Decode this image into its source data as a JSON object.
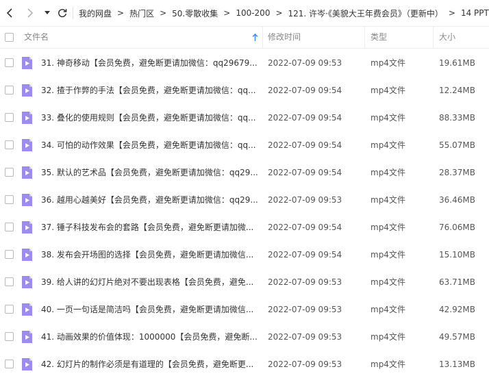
{
  "breadcrumbs": [
    "我的网盘",
    "热门区",
    "50.零散收集",
    "100-200",
    "121. 许岑·《美貌大王年费会员》（更新中）",
    "14 PPT"
  ],
  "columns": {
    "name": "文件名",
    "modified": "修改时间",
    "type": "类型",
    "size": "大小"
  },
  "colors": {
    "accent": "#3b8cff",
    "file_icon": "#9b8bee",
    "file_icon_fold": "#c9c0f7"
  },
  "files": [
    {
      "name": "31. 神奇移动【会员免费，避免断更请加微信：qq29679...",
      "modified": "2022-07-09 09:53",
      "type": "mp4文件",
      "size": "19.61MB"
    },
    {
      "name": "32. 揸于作弊的手法【会员免费，避免断更请加微信：qq...",
      "modified": "2022-07-09 09:54",
      "type": "mp4文件",
      "size": "12.24MB"
    },
    {
      "name": "33. 叠化的使用规则【会员免费，避免断更请加微信：qq...",
      "modified": "2022-07-09 09:54",
      "type": "mp4文件",
      "size": "88.33MB"
    },
    {
      "name": "34. 可怕的动作效果【会员免费，避免断更请加微信：qq...",
      "modified": "2022-07-09 09:54",
      "type": "mp4文件",
      "size": "55.07MB"
    },
    {
      "name": "35. 默认的艺术品【会员免费，避免断更请加微信：qq29...",
      "modified": "2022-07-09 09:54",
      "type": "mp4文件",
      "size": "28.37MB"
    },
    {
      "name": "36. 越用心越美好【会员免费，避免断更请加微信：qq29...",
      "modified": "2022-07-09 09:53",
      "type": "mp4文件",
      "size": "36.46MB"
    },
    {
      "name": "37. 锤子科技发布会的套路【会员免费，避免断更请加微...",
      "modified": "2022-07-09 09:54",
      "type": "mp4文件",
      "size": "76.06MB"
    },
    {
      "name": "38. 发布会开场图的选择【会员免费，避免断更请加微信...",
      "modified": "2022-07-09 09:54",
      "type": "mp4文件",
      "size": "15.10MB"
    },
    {
      "name": "39. 给人讲的幻灯片绝对不要出现表格【会员免费，避免...",
      "modified": "2022-07-09 09:53",
      "type": "mp4文件",
      "size": "63.71MB"
    },
    {
      "name": "40. 一页一句话是简洁吗【会员免费，避免断更请加微信...",
      "modified": "2022-07-09 09:53",
      "type": "mp4文件",
      "size": "42.92MB"
    },
    {
      "name": "41. 动画效果的价值体现：1000000【会员免费，避免断...",
      "modified": "2022-07-09 09:53",
      "type": "mp4文件",
      "size": "49.57MB"
    },
    {
      "name": "42. 幻灯片的制作必须是有道理的【会员免费，避免断更...",
      "modified": "2022-07-09 09:53",
      "type": "mp4文件",
      "size": "13.13MB"
    }
  ]
}
